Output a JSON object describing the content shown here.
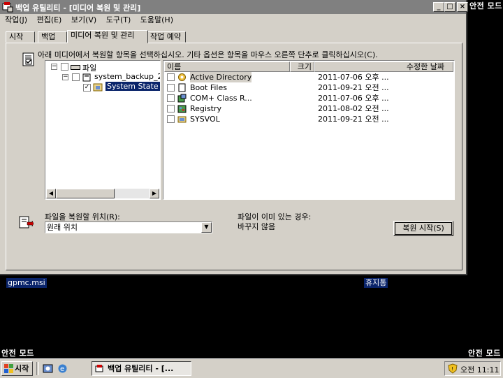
{
  "safe_mode": {
    "top_right": "안전 모드",
    "bottom_left": "안전 모드",
    "bottom_right": "안전 모드"
  },
  "window": {
    "title": "백업 유틸리티 - [미디어 복원 및 관리]",
    "menu": [
      "작업(J)",
      "편집(E)",
      "보기(V)",
      "도구(T)",
      "도움말(H)"
    ],
    "tabs": [
      "시작",
      "백업",
      "미디어 복원 및 관리",
      "작업 예약"
    ],
    "active_tab": 2,
    "instruction": "아래 미디어에서 복원할 항목을 선택하십시오. 기타 옵션은 항목을 마우스 오른쪽 단추로 클릭하십시오(C).",
    "tree": {
      "root": "파일",
      "child": "system_backup_2",
      "grandchild": "System State"
    },
    "list": {
      "columns": [
        "이름",
        "크기",
        "수정한 날짜"
      ],
      "rows": [
        {
          "name": "Active Directory",
          "size": "",
          "date": "2011-07-06 오후 ...",
          "icon": "active-directory-icon"
        },
        {
          "name": "Boot Files",
          "size": "",
          "date": "2011-09-21 오전 ...",
          "icon": "file-icon"
        },
        {
          "name": "COM+ Class R...",
          "size": "",
          "date": "2011-07-06 오후 ...",
          "icon": "component-icon"
        },
        {
          "name": "Registry",
          "size": "",
          "date": "2011-08-02 오전 ...",
          "icon": "registry-icon"
        },
        {
          "name": "SYSVOL",
          "size": "",
          "date": "2011-09-21 오전 ...",
          "icon": "folder-icon"
        }
      ]
    },
    "restore_location_label": "파일을 복원할 위치(R):",
    "restore_location_value": "원래 위치",
    "exists_label": "파일이 이미 있는 경우:",
    "exists_value": "바꾸지 않음",
    "start_restore_button": "복원 시작(S)"
  },
  "desktop": {
    "icon_left": "gpmc.msi",
    "icon_right": "휴지통"
  },
  "taskbar": {
    "start": "시작",
    "task": "백업 유틸리티 - [...",
    "clock": "오전 11:11"
  }
}
